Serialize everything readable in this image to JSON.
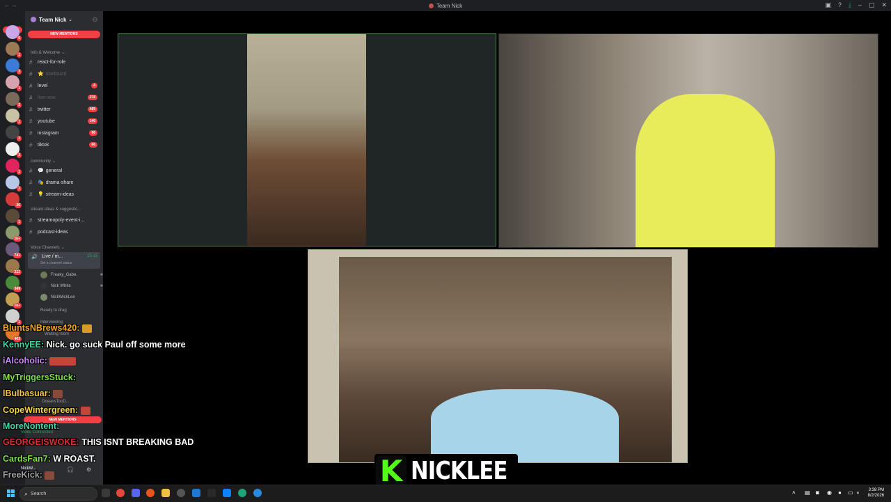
{
  "window": {
    "title": "Team Nick"
  },
  "rail": {
    "new_label": "NEW",
    "badges": [
      "6",
      "1",
      "3",
      "1",
      "3",
      "1",
      "1",
      "3",
      "1",
      "1",
      "26",
      "1",
      "1k+",
      "741",
      "212",
      "349",
      "1k+",
      "1",
      "463"
    ]
  },
  "sidebar": {
    "guild_name": "Team Nick",
    "new_mentions": "NEW MENTIONS",
    "categories": {
      "info": "Info & Welcome",
      "community": "community",
      "stream_ideas": "stream ideas & suggestio...",
      "voice": "Voice Channels"
    },
    "channels": [
      {
        "name": "react-for-role",
        "count": ""
      },
      {
        "name": "starboard",
        "count": ""
      },
      {
        "name": "level",
        "count": "4"
      },
      {
        "name": "live-now",
        "count": "278"
      },
      {
        "name": "twitter",
        "count": "489"
      },
      {
        "name": "youtube",
        "count": "146"
      },
      {
        "name": "instagram",
        "count": "96"
      },
      {
        "name": "tiktok",
        "count": "66"
      },
      {
        "name": "general",
        "count": ""
      },
      {
        "name": "drama-share",
        "count": ""
      },
      {
        "name": "stream-ideas",
        "count": ""
      },
      {
        "name": "streamopoly-event-i...",
        "count": ""
      },
      {
        "name": "podcast-ideas",
        "count": ""
      }
    ],
    "voice_channel": {
      "name": "Live / m...",
      "time": "15:15",
      "status": "Set a channel status"
    },
    "members": [
      "Freaky_Gabe.",
      "Nick White",
      "NickWickLee"
    ],
    "lower": [
      "Ready to drag",
      "Interviewing",
      "Waiting room",
      "OceansTooD..."
    ],
    "video_connected": "Video Connected",
    "user_name": "NickW..."
  },
  "chat": [
    {
      "user": "BluntsNBrews420:",
      "color": "#f5a623",
      "text": ""
    },
    {
      "user": "KennyEE:",
      "color": "#3ed6a7",
      "text": " Nick. go suck Paul off some more"
    },
    {
      "user": "iAlcoholic:",
      "color": "#c98bf5",
      "text": ""
    },
    {
      "user": "MyTriggersStuck:",
      "color": "#7fe04a",
      "text": ""
    },
    {
      "user": "lBulbasuar:",
      "color": "#f5c542",
      "text": ""
    },
    {
      "user": "CopeWintergreen:",
      "color": "#f5d142",
      "text": ""
    },
    {
      "user": "MoreNontent:",
      "color": "#3ed6a7",
      "text": ""
    },
    {
      "user": "GEORGEISWOKE:",
      "color": "#d9302e",
      "text": " THIS ISNT BREAKING BAD"
    },
    {
      "user": "CardsFan7:",
      "color": "#7fe04a",
      "text": " W ROAST."
    },
    {
      "user": "FreeKick:",
      "color": "#a0a0a0",
      "text": ""
    }
  ],
  "overlay": {
    "k": "K",
    "name": "NICKLEE"
  },
  "taskbar": {
    "search_placeholder": "Search",
    "time": "3:38 PM",
    "date": "8/2/2026"
  }
}
